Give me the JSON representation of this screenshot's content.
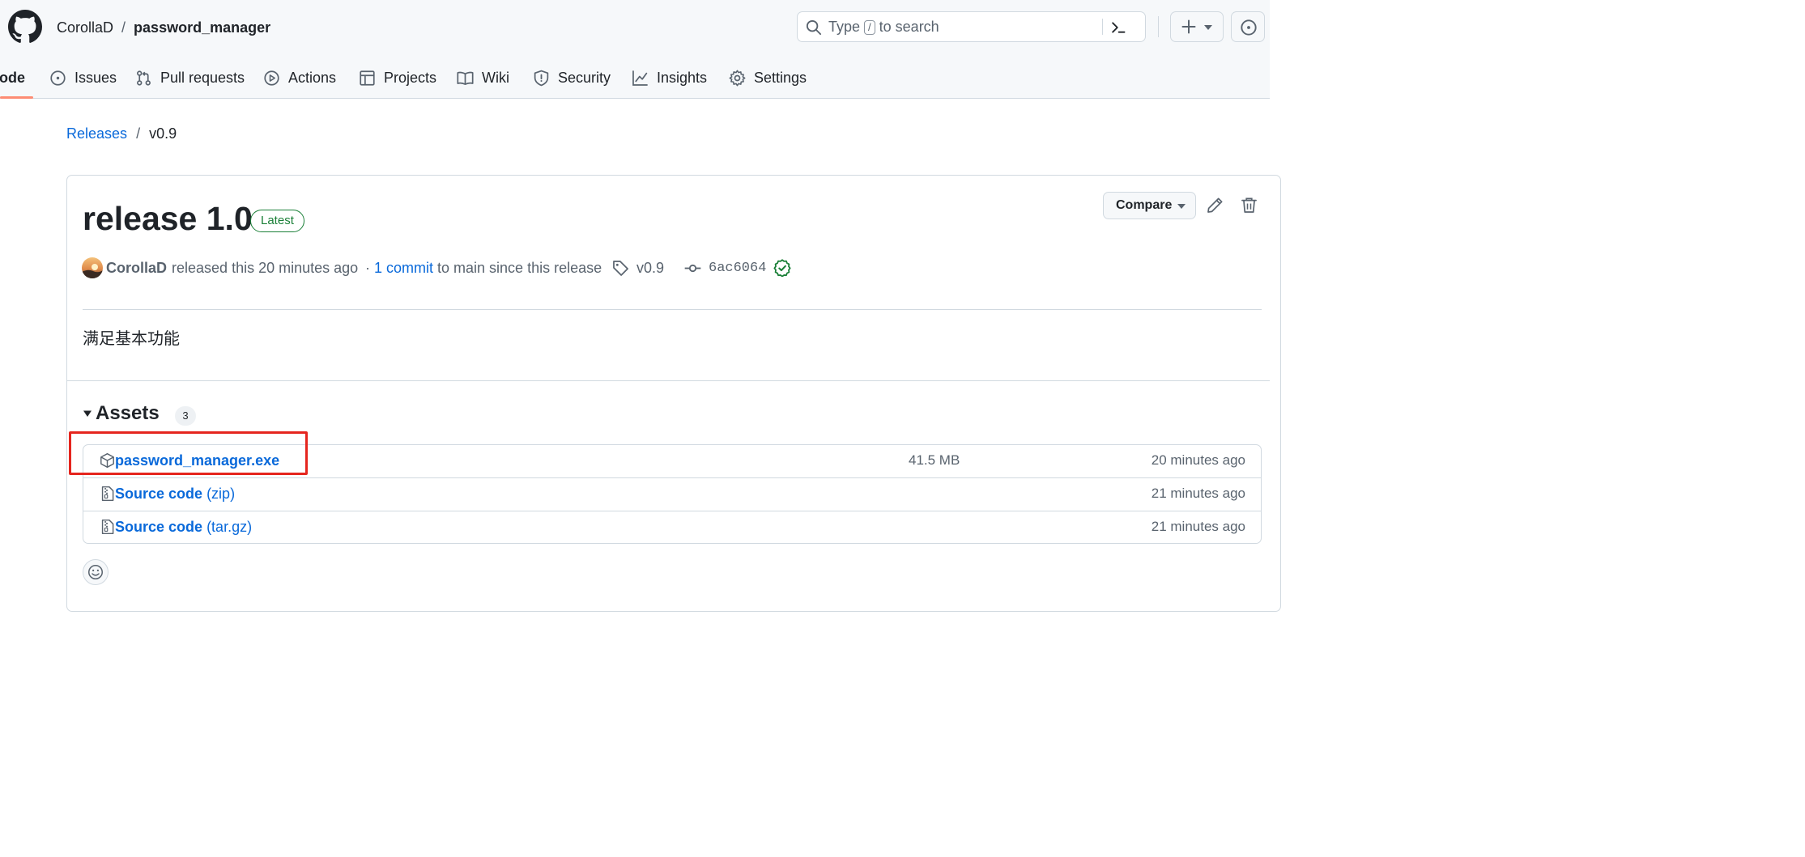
{
  "colors": {
    "link": "#0969da",
    "text": "#1f2328",
    "muted": "#59636e",
    "border": "#d1d9e0",
    "success": "#1a7f37",
    "active_tab_underline": "#fd8c73",
    "highlight_box": "#e5251e"
  },
  "header": {
    "logo_icon": "github-mark-icon",
    "owner": "CorollaD",
    "separator": "/",
    "repo": "password_manager",
    "search": {
      "prefix": "Type",
      "key": "/",
      "suffix": "to search"
    },
    "icons": [
      "search-icon",
      "command-palette-icon",
      "plus-icon",
      "caret-down-icon",
      "issue-opened-icon"
    ]
  },
  "tabs": [
    {
      "label": "Code",
      "icon": "code-icon",
      "active": true
    },
    {
      "label": "Issues",
      "icon": "issue-opened-icon"
    },
    {
      "label": "Pull requests",
      "icon": "git-pull-request-icon"
    },
    {
      "label": "Actions",
      "icon": "play-icon"
    },
    {
      "label": "Projects",
      "icon": "table-icon"
    },
    {
      "label": "Wiki",
      "icon": "book-icon"
    },
    {
      "label": "Security",
      "icon": "shield-icon"
    },
    {
      "label": "Insights",
      "icon": "graph-icon"
    },
    {
      "label": "Settings",
      "icon": "gear-icon"
    }
  ],
  "breadcrumb": {
    "releases_label": "Releases",
    "separator": "/",
    "current": "v0.9"
  },
  "release": {
    "title": "release 1.0",
    "badge": "Latest",
    "compare_label": "Compare",
    "author": "CorollaD",
    "released_text": "released this 20 minutes ago",
    "commits_prefix": "·",
    "commits_link": "1 commit",
    "commits_suffix": "to main since this release",
    "tag": "v0.9",
    "commit_sha": "6ac6064",
    "verified_icon": "check-circle-icon",
    "notes": "满足基本功能"
  },
  "assets": {
    "title": "Assets",
    "count": "3",
    "items": [
      {
        "name": "password_manager.exe",
        "ext": "",
        "size": "41.5 MB",
        "time": "20 minutes ago",
        "icon": "package-icon",
        "highlighted": true
      },
      {
        "name": "Source code",
        "ext": "(zip)",
        "size": "",
        "time": "21 minutes ago",
        "icon": "file-zip-icon"
      },
      {
        "name": "Source code",
        "ext": "(tar.gz)",
        "size": "",
        "time": "21 minutes ago",
        "icon": "file-zip-icon"
      }
    ]
  },
  "reactions": {
    "icon": "smiley-icon"
  }
}
